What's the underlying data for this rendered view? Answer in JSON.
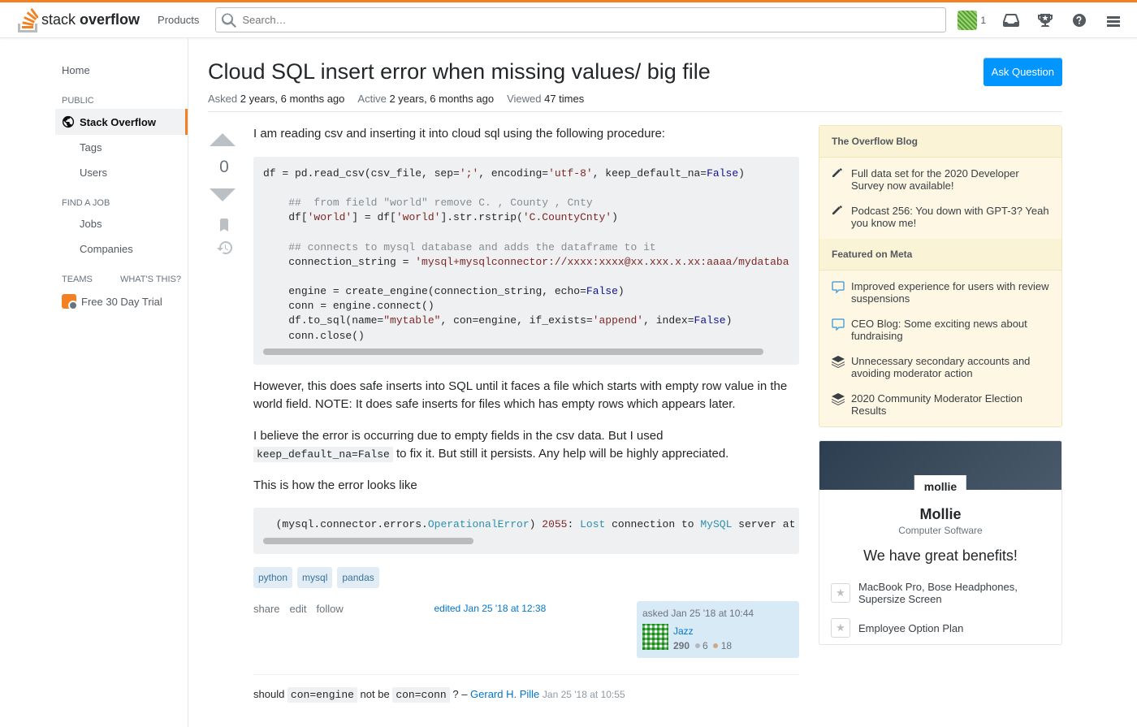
{
  "header": {
    "logo_text_light": "stack",
    "logo_text_bold": "overflow",
    "products_label": "Products",
    "search_placeholder": "Search…",
    "reputation": "1"
  },
  "left_nav": {
    "home": "Home",
    "public_header": "PUBLIC",
    "stack_overflow": "Stack Overflow",
    "tags": "Tags",
    "users": "Users",
    "find_job_header": "FIND A JOB",
    "jobs": "Jobs",
    "companies": "Companies",
    "teams_header": "TEAMS",
    "whats_this": "What's this?",
    "free_trial": "Free 30 Day Trial"
  },
  "question": {
    "title": "Cloud SQL insert error when missing values/ big file",
    "ask_button": "Ask Question",
    "asked_label": "Asked",
    "asked_val": "2 years, 6 months ago",
    "active_label": "Active",
    "active_val": "2 years, 6 months ago",
    "viewed_label": "Viewed",
    "viewed_val": "47 times",
    "vote_count": "0",
    "p1": "I am reading csv and inserting it into cloud sql using the following procedure:",
    "p2": "However, this does safe inserts into SQL until it faces a file which starts with empty row value in the world field. NOTE: It does safe inserts for files which has empty rows which appears later.",
    "p3_a": "I believe the error is occurring due to empty fields in the csv data. But I used ",
    "p3_code": "keep_default_na=False",
    "p3_b": " to fix it. But still it persists. Any help will be highly appreciated.",
    "p4": "This is how the error looks like",
    "tags": [
      "python",
      "mysql",
      "pandas"
    ],
    "actions": {
      "share": "share",
      "edit": "edit",
      "follow": "follow"
    },
    "edited": "edited Jan 25 '18 at 12:38",
    "asked_card": {
      "when": "asked Jan 25 '18 at 10:44",
      "name": "Jazz",
      "rep": "290",
      "silver": "6",
      "bronze": "18"
    },
    "comment": {
      "text_a": "should ",
      "code1": "con=engine",
      "mid": " not be ",
      "code2": "con=conn",
      "tail": " ? – ",
      "author": "Gerard H. Pille",
      "date": "Jan 25 '18 at 10:55"
    }
  },
  "code1": {
    "l1a": "df = pd.read_csv(csv_file, sep=",
    "l1b": "';'",
    "l1c": ", encoding=",
    "l1d": "'utf-8'",
    "l1e": ", keep_default_na=",
    "l1f": "False",
    "l1g": ")",
    "l2": "##  from field \"world\" remove C. , County , Cnty",
    "l3a": "df[",
    "l3b": "'world'",
    "l3c": "] = df[",
    "l3d": "'world'",
    "l3e": "].str.rstrip(",
    "l3f": "'C.CountyCnty'",
    "l3g": ")",
    "l4": "## connects to mysql database and adds the dataframe to it",
    "l5a": "connection_string = ",
    "l5b": "'mysql+mysqlconnector://xxxx:xxxx@xx.xxx.x.xx:aaaa/mydataba",
    "l6a": "engine = create_engine(connection_string, echo=",
    "l6b": "False",
    "l6c": ")",
    "l7": "conn = engine.connect()",
    "l8a": "df.to_sql(name=",
    "l8b": "\"mytable\"",
    "l8c": ", con=engine, if_exists=",
    "l8d": "'append'",
    "l8e": ", index=",
    "l8f": "False",
    "l8g": ")",
    "l9": "conn.close()"
  },
  "code2": {
    "a": "(mysql.connector.errors.",
    "b": "OperationalError",
    "c": ") ",
    "d": "2055",
    "e": ": ",
    "f": "Lost",
    "g": " connection to ",
    "h": "MySQL",
    "i": " server at"
  },
  "sidebar": {
    "blog_header": "The Overflow Blog",
    "blog_items": [
      "Full data set for the 2020 Developer Survey now available!",
      "Podcast 256: You down with GPT-3? Yeah you know me!"
    ],
    "meta_header": "Featured on Meta",
    "meta_items": [
      "Improved experience for users with review suspensions",
      "CEO Blog: Some exciting news about fundraising",
      "Unnecessary secondary accounts and avoiding moderator action",
      "2020 Community Moderator Election Results"
    ],
    "ad": {
      "logo": "mollie",
      "company": "Mollie",
      "industry": "Computer Software",
      "benefits_head": "We have great benefits!",
      "b1": "MacBook Pro, Bose Headphones, Supersize Screen",
      "b2": "Employee Option Plan"
    }
  }
}
